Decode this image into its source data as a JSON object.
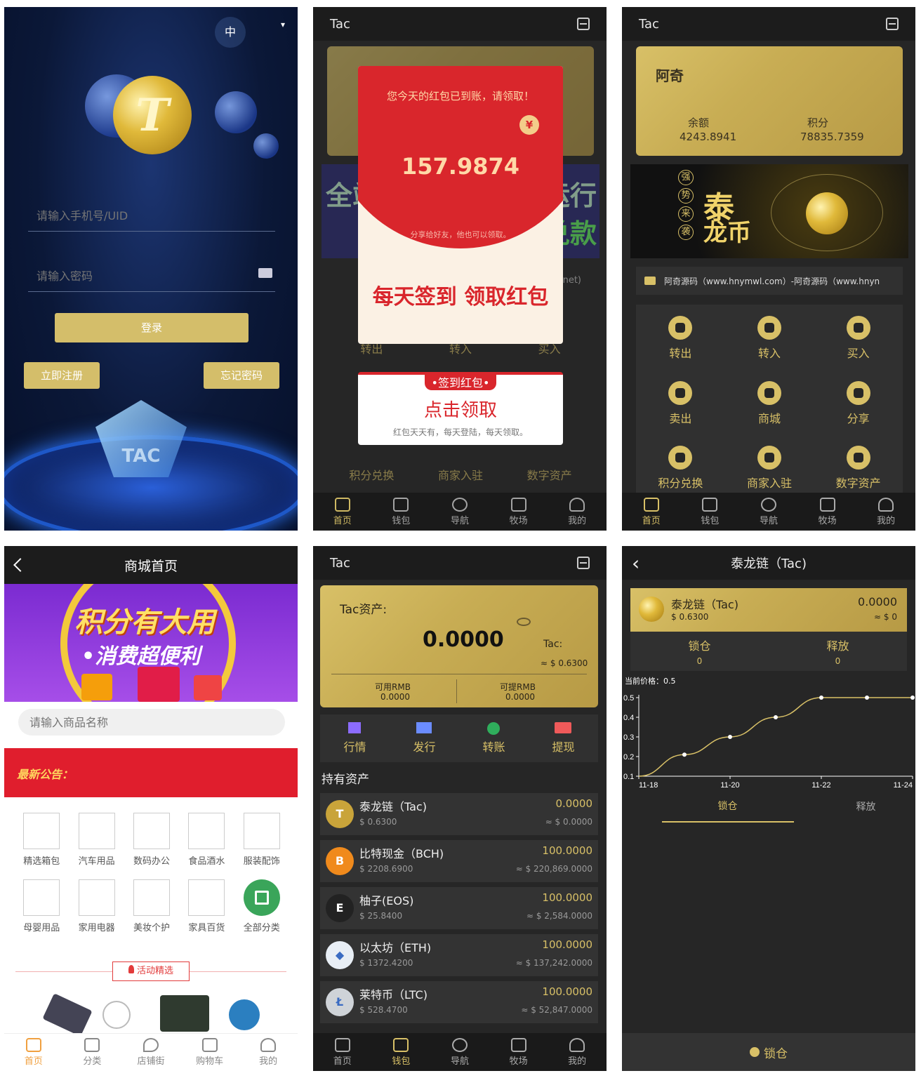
{
  "login": {
    "lang": "中",
    "lang_caret": "▾",
    "phone_placeholder": "请输入手机号/UID",
    "password_placeholder": "请输入密码",
    "login_label": "登录",
    "register_label": "立即注册",
    "forgot_label": "忘记密码",
    "logo_text": "TAC",
    "coin_letter": "T"
  },
  "redpacket": {
    "title": "Tac",
    "notice": "您今天的红包已到账，请领取！",
    "yen": "¥",
    "amount": "157.9874",
    "share_text": "分享给好友，他也可以领取。",
    "slogan": "每天签到 领取红包",
    "bg_banner_left": "全站",
    "bg_banner_right": "运行",
    "bg_banner_right2": "兑款",
    "bg_domain": "net)",
    "bg_actions": [
      "转出",
      "转入",
      "买入"
    ],
    "bg_grid": [
      "积分兑换",
      "商家入驻",
      "数字资产"
    ],
    "ticket_header": "•签到红包•",
    "ticket_title": "点击领取",
    "ticket_sub": "红包天天有，每天登陆，每天领取。"
  },
  "dashboard": {
    "title": "Tac",
    "user": "阿奇",
    "balance_label": "余额",
    "balance": "4243.8941",
    "points_label": "积分",
    "points": "78835.7359",
    "banner_line1": "泰",
    "banner_line2": "龙币",
    "banner_vertical": [
      "强",
      "势",
      "来",
      "袭"
    ],
    "marquee": "阿奇源码（www.hnymwl.com）-阿奇源码（www.hnyn",
    "grid": [
      "转出",
      "转入",
      "买入",
      "卖出",
      "商城",
      "分享",
      "积分兑换",
      "商家入驻",
      "数字资产"
    ]
  },
  "tabs": {
    "items": [
      "首页",
      "钱包",
      "导航",
      "牧场",
      "我的"
    ]
  },
  "mall": {
    "title": "商城首页",
    "banner_line1": "积分有大用",
    "banner_line2": "•消费超便利",
    "search_placeholder": "请输入商品名称",
    "notice_label": "最新公告：",
    "categories": [
      "精选箱包",
      "汽车用品",
      "数码办公",
      "食品酒水",
      "服装配饰",
      "母婴用品",
      "家用电器",
      "美妆个护",
      "家具百货",
      "全部分类"
    ],
    "activity": "活动精选",
    "tabs": [
      "首页",
      "分类",
      "店铺街",
      "购物车",
      "我的"
    ]
  },
  "wallet": {
    "title": "Tac",
    "asset_label": "Tac资产:",
    "amount": "0.0000",
    "unit": "Tac:",
    "approx": "≈ $ 0.6300",
    "available_label": "可用RMB",
    "available": "0.0000",
    "withdrawable_label": "可提RMB",
    "withdrawable": "0.0000",
    "actions": [
      "行情",
      "发行",
      "转账",
      "提现"
    ],
    "holdings_label": "持有资产",
    "assets": [
      {
        "name": "泰龙链（Tac)",
        "price": "$ 0.6300",
        "amount": "0.0000",
        "value": "≈ $ 0.0000",
        "color": "#c9a43a",
        "glyph": "T"
      },
      {
        "name": "比特现金（BCH)",
        "price": "$ 2208.6900",
        "amount": "100.0000",
        "value": "≈ $ 220,869.0000",
        "color": "#f08a1c",
        "glyph": "B"
      },
      {
        "name": "柚子(EOS)",
        "price": "$ 25.8400",
        "amount": "100.0000",
        "value": "≈ $ 2,584.0000",
        "color": "#222",
        "glyph": "E"
      },
      {
        "name": "以太坊（ETH)",
        "price": "$ 1372.4200",
        "amount": "100.0000",
        "value": "≈ $ 137,242.0000",
        "color": "#e8eef5",
        "glyph": "◆"
      },
      {
        "name": "莱特币（LTC)",
        "price": "$ 528.4700",
        "amount": "100.0000",
        "value": "≈ $ 52,847.0000",
        "color": "#cfd3d8",
        "glyph": "Ł"
      }
    ]
  },
  "detail": {
    "title": "泰龙链（Tac)",
    "back": "‹",
    "coin_name": "泰龙链（Tac)",
    "coin_price": "$ 0.6300",
    "coin_amount": "0.0000",
    "coin_value": "≈ $ 0",
    "lock_label": "锁仓",
    "lock_value": "0",
    "release_label": "释放",
    "release_value": "0",
    "current_price": "当前价格：0.5",
    "tab_lock": "锁仓",
    "tab_release": "释放",
    "bottom_button": "锁仓"
  },
  "chart_data": {
    "type": "line",
    "x": [
      "11-18",
      "11-19",
      "11-20",
      "11-21",
      "11-22",
      "11-23",
      "11-24"
    ],
    "values": [
      0.1,
      0.21,
      0.3,
      0.4,
      0.5,
      0.5,
      0.5
    ],
    "xticks": [
      "11-18",
      "11-20",
      "11-22",
      "11-24"
    ],
    "yticks": [
      "0.1",
      "0.2",
      "0.3",
      "0.4",
      "0.5"
    ],
    "ylim": [
      0.1,
      0.5
    ],
    "color": "#d8c067"
  }
}
